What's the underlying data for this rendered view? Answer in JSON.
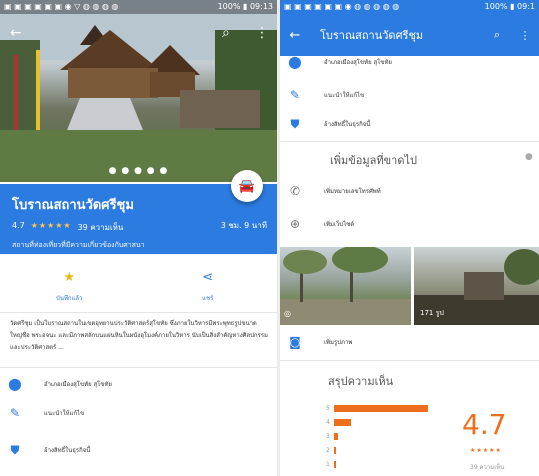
{
  "status_bar": {
    "left": "▣ ▣ ▣ ▣ ▣ ▣ ◉ ▽ ◍ ◍ ◍ ◍",
    "right": "100% ▮ 09:13"
  },
  "status_bar_right": {
    "left": "▣ ▣ ▣ ▣ ▣ ▣ ◉ ◍ ◍ ◍ ◍ ◍",
    "right": "100% ▮ 09:1"
  },
  "place": {
    "name": "โบราณสถานวัดศรีชุม",
    "rating": "4.7",
    "stars": "★★★★★",
    "review_count": "39 ความเห็น",
    "type": "สถานที่ท่องเที่ยวที่มีความเกี่ยวข้องกับศาสนา",
    "duration": "3 ชม. 9 นาที"
  },
  "photo_dots": "● ● ● ● ●",
  "actions": [
    {
      "label": "บันทึกแล้ว",
      "icon": "star-icon"
    },
    {
      "label": "แชร์",
      "icon": "share-icon"
    }
  ],
  "description": "วัดศรีชุม เป็นโบราณสถานในเขตอุทยานประวัติศาสตร์สุโขทัย ซึ่งภายในวิหารมีพระพุทธรูปขนาดใหญ่ชื่อ พระอจนะ และมีภาพสลักบนแผ่นหินในผนังอุโมงค์ภายในวิหาร นับเป็นสิ่งสำคัญทางศิลปกรรมและประวัติศาสตร์ ...",
  "left_info_rows": [
    {
      "icon": "location-pin-icon",
      "text": "อำเภอเมืองสุโขทัย สุโขทัย"
    },
    {
      "icon": "edit-pencil-icon",
      "text": "แนะนำให้แก้ไข"
    },
    {
      "icon": "verified-shield-icon",
      "text": "อ้างสิทธิ์ในธุรกิจนี้"
    }
  ],
  "right": {
    "app_title": "โบราณสถานวัดศรีชุม",
    "top_rows": [
      {
        "icon": "location-pin-icon",
        "text": "อำเภอเมืองสุโขทัย สุโขทัย"
      },
      {
        "icon": "edit-pencil-icon",
        "text": "แนะนำให้แก้ไข"
      },
      {
        "icon": "verified-shield-icon",
        "text": "อ้างสิทธิ์ในธุรกิจนี้"
      }
    ],
    "missing_info_title": "เพิ่มข้อมูลที่ขาดไป",
    "missing_rows": [
      {
        "icon": "phone-icon",
        "text": "เพิ่มหมายเลขโทรศัพท์"
      },
      {
        "icon": "globe-icon",
        "text": "เพิ่มเว็บไซต์"
      }
    ],
    "photo_count": "171 รูป",
    "add_photo": "เพิ่มรูปภาพ",
    "review_summary_title": "สรุปความเห็น",
    "histogram": [
      {
        "label": "5",
        "fraction": 0.78
      },
      {
        "label": "4",
        "fraction": 0.14
      },
      {
        "label": "3",
        "fraction": 0.03
      },
      {
        "label": "2",
        "fraction": 0.0
      },
      {
        "label": "1",
        "fraction": 0.02
      }
    ],
    "rating": "4.7",
    "stars": "★★★★★",
    "review_count": "39 ความเห็น"
  },
  "colors": {
    "accent": "#2c7be0",
    "review_bar": "#ee6e1e",
    "star_gold": "#ffc34d"
  }
}
